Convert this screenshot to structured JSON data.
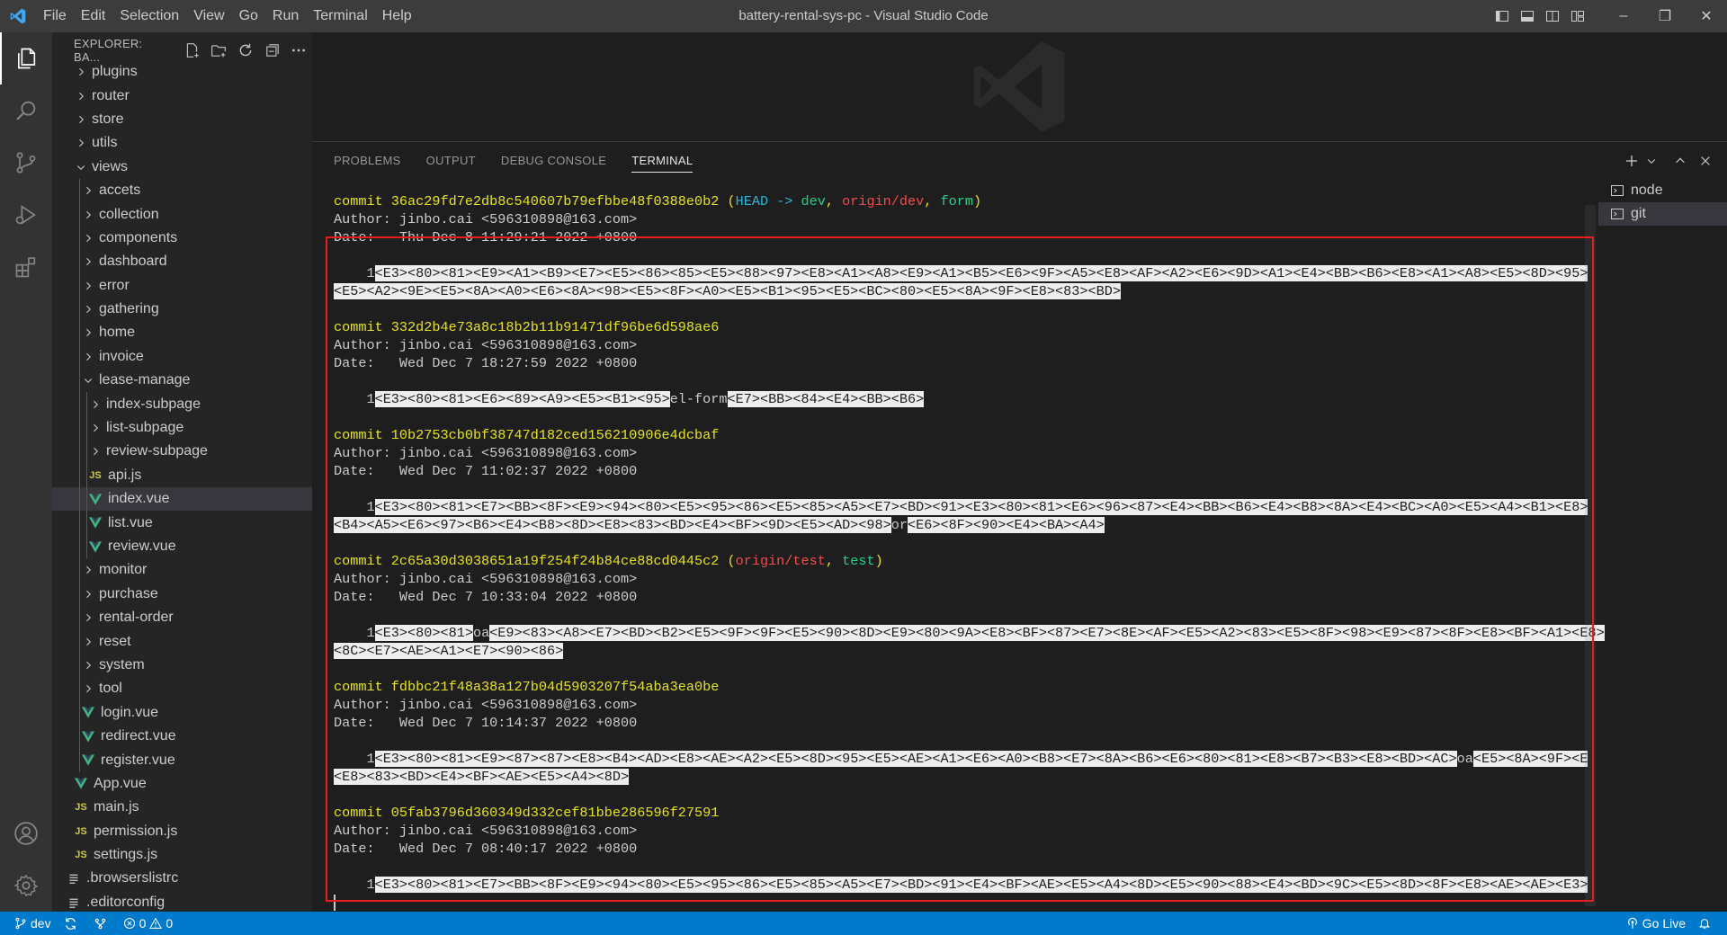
{
  "window": {
    "title": "battery-rental-sys-pc - Visual Studio Code"
  },
  "menu": [
    "File",
    "Edit",
    "Selection",
    "View",
    "Go",
    "Run",
    "Terminal",
    "Help"
  ],
  "window_controls": {
    "minimize": "–",
    "restore": "❐",
    "close": "✕"
  },
  "sidebar": {
    "header": "EXPLORER: BA...",
    "tree": [
      {
        "label": "plugins",
        "type": "folder",
        "depth": 1,
        "open": false,
        "clipped": true
      },
      {
        "label": "router",
        "type": "folder",
        "depth": 1,
        "open": false
      },
      {
        "label": "store",
        "type": "folder",
        "depth": 1,
        "open": false
      },
      {
        "label": "utils",
        "type": "folder",
        "depth": 1,
        "open": false
      },
      {
        "label": "views",
        "type": "folder",
        "depth": 1,
        "open": true
      },
      {
        "label": "accets",
        "type": "folder",
        "depth": 2,
        "open": false
      },
      {
        "label": "collection",
        "type": "folder",
        "depth": 2,
        "open": false
      },
      {
        "label": "components",
        "type": "folder",
        "depth": 2,
        "open": false
      },
      {
        "label": "dashboard",
        "type": "folder",
        "depth": 2,
        "open": false
      },
      {
        "label": "error",
        "type": "folder",
        "depth": 2,
        "open": false
      },
      {
        "label": "gathering",
        "type": "folder",
        "depth": 2,
        "open": false
      },
      {
        "label": "home",
        "type": "folder",
        "depth": 2,
        "open": false
      },
      {
        "label": "invoice",
        "type": "folder",
        "depth": 2,
        "open": false
      },
      {
        "label": "lease-manage",
        "type": "folder",
        "depth": 2,
        "open": true
      },
      {
        "label": "index-subpage",
        "type": "folder",
        "depth": 3,
        "open": false
      },
      {
        "label": "list-subpage",
        "type": "folder",
        "depth": 3,
        "open": false
      },
      {
        "label": "review-subpage",
        "type": "folder",
        "depth": 3,
        "open": false
      },
      {
        "label": "api.js",
        "type": "js",
        "depth": 3
      },
      {
        "label": "index.vue",
        "type": "vue",
        "depth": 3,
        "selected": true
      },
      {
        "label": "list.vue",
        "type": "vue",
        "depth": 3
      },
      {
        "label": "review.vue",
        "type": "vue",
        "depth": 3
      },
      {
        "label": "monitor",
        "type": "folder",
        "depth": 2,
        "open": false
      },
      {
        "label": "purchase",
        "type": "folder",
        "depth": 2,
        "open": false
      },
      {
        "label": "rental-order",
        "type": "folder",
        "depth": 2,
        "open": false
      },
      {
        "label": "reset",
        "type": "folder",
        "depth": 2,
        "open": false
      },
      {
        "label": "system",
        "type": "folder",
        "depth": 2,
        "open": false
      },
      {
        "label": "tool",
        "type": "folder",
        "depth": 2,
        "open": false
      },
      {
        "label": "login.vue",
        "type": "vue",
        "depth": 2
      },
      {
        "label": "redirect.vue",
        "type": "vue",
        "depth": 2
      },
      {
        "label": "register.vue",
        "type": "vue",
        "depth": 2
      },
      {
        "label": "App.vue",
        "type": "vue",
        "depth": 1
      },
      {
        "label": "main.js",
        "type": "js",
        "depth": 1
      },
      {
        "label": "permission.js",
        "type": "js",
        "depth": 1
      },
      {
        "label": "settings.js",
        "type": "js",
        "depth": 1
      },
      {
        "label": ".browserslistrc",
        "type": "cfg",
        "depth": 0
      },
      {
        "label": ".editorconfig",
        "type": "cfg",
        "depth": 0
      }
    ]
  },
  "panel": {
    "tabs": [
      {
        "label": "PROBLEMS",
        "active": false
      },
      {
        "label": "OUTPUT",
        "active": false
      },
      {
        "label": "DEBUG CONSOLE",
        "active": false
      },
      {
        "label": "TERMINAL",
        "active": true
      }
    ],
    "terminal_list": [
      {
        "label": "node",
        "active": false
      },
      {
        "label": "git",
        "active": true
      }
    ],
    "terminal_lines": [
      {
        "segs": [
          {
            "t": "commit 36ac29fd7e2db8c540607b79efbbe48f0388e0b2 ",
            "c": "yellow"
          },
          {
            "t": "(",
            "c": "yellow"
          },
          {
            "t": "HEAD -> ",
            "c": "cyan"
          },
          {
            "t": "dev",
            "c": "green"
          },
          {
            "t": ", ",
            "c": "yellow"
          },
          {
            "t": "origin/dev",
            "c": "red"
          },
          {
            "t": ", ",
            "c": "yellow"
          },
          {
            "t": "form",
            "c": "green"
          },
          {
            "t": ")",
            "c": "yellow"
          }
        ]
      },
      {
        "segs": [
          {
            "t": "Author: jinbo.cai <596310898@163.com>",
            "c": ""
          }
        ]
      },
      {
        "segs": [
          {
            "t": "Date:   Thu Dec 8 11:29:21 2022 +0800",
            "c": ""
          }
        ]
      },
      {
        "blank": true
      },
      {
        "segs": [
          {
            "t": "    1",
            "c": ""
          },
          {
            "t": "<E3><80><81><E9><A1><B9><E7><E5><86><85><E5><88><97><E8><A1><A8><E9><A1><B5><E6><9F><A5><E8><AF><A2><E6><9D><A1><E4><BB><B6><E8><A1><A8><E5><8D><95>",
            "c": "hl"
          }
        ]
      },
      {
        "segs": [
          {
            "t": "<E5><A2><9E><E5><8A><A0><E6><8A><98><E5><8F><A0><E5><B1><95><E5><BC><80><E5><8A><9F><E8><83><BD>",
            "c": "hl"
          }
        ]
      },
      {
        "blank": true
      },
      {
        "segs": [
          {
            "t": "commit 332d2b4e73a8c18b2b11b91471df96be6d598ae6",
            "c": "yellow"
          }
        ]
      },
      {
        "segs": [
          {
            "t": "Author: jinbo.cai <596310898@163.com>",
            "c": ""
          }
        ]
      },
      {
        "segs": [
          {
            "t": "Date:   Wed Dec 7 18:27:59 2022 +0800",
            "c": ""
          }
        ]
      },
      {
        "blank": true
      },
      {
        "segs": [
          {
            "t": "    1",
            "c": ""
          },
          {
            "t": "<E3><80><81><E6><89><A9><E5><B1><95>",
            "c": "hl"
          },
          {
            "t": "el-form",
            "c": ""
          },
          {
            "t": "<E7><BB><84><E4><BB><B6>",
            "c": "hl"
          }
        ]
      },
      {
        "blank": true
      },
      {
        "segs": [
          {
            "t": "commit 10b2753cb0bf38747d182ced156210906e4dcbaf",
            "c": "yellow"
          }
        ]
      },
      {
        "segs": [
          {
            "t": "Author: jinbo.cai <596310898@163.com>",
            "c": ""
          }
        ]
      },
      {
        "segs": [
          {
            "t": "Date:   Wed Dec 7 11:02:37 2022 +0800",
            "c": ""
          }
        ]
      },
      {
        "blank": true
      },
      {
        "segs": [
          {
            "t": "    1",
            "c": ""
          },
          {
            "t": "<E3><80><81><E7><BB><8F><E9><94><80><E5><95><86><E5><85><A5><E7><BD><91><E3><80><81><E6><96><87><E4><BB><B6><E4><B8><8A><E4><BC><A0><E5><A4><B1><E8>",
            "c": "hl"
          }
        ]
      },
      {
        "segs": [
          {
            "t": "<B4><A5><E6><97><B6><E4><B8><8D><E8><83><BD><E4><BF><9D><E5><AD><98>",
            "c": "hl"
          },
          {
            "t": "or",
            "c": ""
          },
          {
            "t": "<E6><8F><90><E4><BA><A4>",
            "c": "hl"
          }
        ]
      },
      {
        "blank": true
      },
      {
        "segs": [
          {
            "t": "commit 2c65a30d3038651a19f254f24b84ce88cd0445c2 ",
            "c": "yellow"
          },
          {
            "t": "(",
            "c": "yellow"
          },
          {
            "t": "origin/test",
            "c": "red"
          },
          {
            "t": ", ",
            "c": "yellow"
          },
          {
            "t": "test",
            "c": "green"
          },
          {
            "t": ")",
            "c": "yellow"
          }
        ]
      },
      {
        "segs": [
          {
            "t": "Author: jinbo.cai <596310898@163.com>",
            "c": ""
          }
        ]
      },
      {
        "segs": [
          {
            "t": "Date:   Wed Dec 7 10:33:04 2022 +0800",
            "c": ""
          }
        ]
      },
      {
        "blank": true
      },
      {
        "segs": [
          {
            "t": "    1",
            "c": ""
          },
          {
            "t": "<E3><80><81>",
            "c": "hl"
          },
          {
            "t": "oa",
            "c": ""
          },
          {
            "t": "<E9><83><A8><E7><BD><B2><E5><9F><9F><E5><90><8D><E9><80><9A><E8><BF><87><E7><8E><AF><E5><A2><83><E5><8F><98><E9><87><8F><E8><BF><A1><E8>",
            "c": "hl"
          }
        ]
      },
      {
        "segs": [
          {
            "t": "<8C><E7><AE><A1><E7><90><86>",
            "c": "hl"
          }
        ]
      },
      {
        "blank": true
      },
      {
        "segs": [
          {
            "t": "commit fdbbc21f48a38a127b04d5903207f54aba3ea0be",
            "c": "yellow"
          }
        ]
      },
      {
        "segs": [
          {
            "t": "Author: jinbo.cai <596310898@163.com>",
            "c": ""
          }
        ]
      },
      {
        "segs": [
          {
            "t": "Date:   Wed Dec 7 10:14:37 2022 +0800",
            "c": ""
          }
        ]
      },
      {
        "blank": true
      },
      {
        "segs": [
          {
            "t": "    1",
            "c": ""
          },
          {
            "t": "<E3><80><81><E9><87><87><E8><B4><AD><E8><AE><A2><E5><8D><95><E5><AE><A1><E6><A0><B8><E7><8A><B6><E6><80><81><E8><B7><B3><E8><BD><AC>",
            "c": "hl"
          },
          {
            "t": "oa",
            "c": ""
          },
          {
            "t": "<E5><8A><9F><E",
            "c": "hl"
          }
        ]
      },
      {
        "segs": [
          {
            "t": "<E8><83><BD><E4><BF><AE><E5><A4><8D>",
            "c": "hl"
          }
        ]
      },
      {
        "blank": true
      },
      {
        "segs": [
          {
            "t": "commit 05fab3796d360349d332cef81bbe286596f27591",
            "c": "yellow"
          }
        ]
      },
      {
        "segs": [
          {
            "t": "Author: jinbo.cai <596310898@163.com>",
            "c": ""
          }
        ]
      },
      {
        "segs": [
          {
            "t": "Date:   Wed Dec 7 08:40:17 2022 +0800",
            "c": ""
          }
        ]
      },
      {
        "blank": true
      },
      {
        "segs": [
          {
            "t": "    1",
            "c": ""
          },
          {
            "t": "<E3><80><81><E7><BB><8F><E9><94><80><E5><95><86><E5><85><A5><E7><BD><91><E4><BF><AE><E5><A4><8D><E5><90><88><E4><BD><9C><E5><8D><8F><E8><AE><AE><E3>",
            "c": "hl"
          }
        ]
      },
      {
        "cursor": true
      }
    ]
  },
  "statusbar": {
    "branch": "dev",
    "errors": "0",
    "warnings": "0",
    "golive": "Go Live"
  },
  "colors": {
    "accent": "#007acc",
    "annotation": "#e81c1c",
    "commit_yellow": "#e5e510",
    "ref_red": "#f14c4c",
    "ref_green": "#23d18b",
    "head_cyan": "#29b8db"
  }
}
